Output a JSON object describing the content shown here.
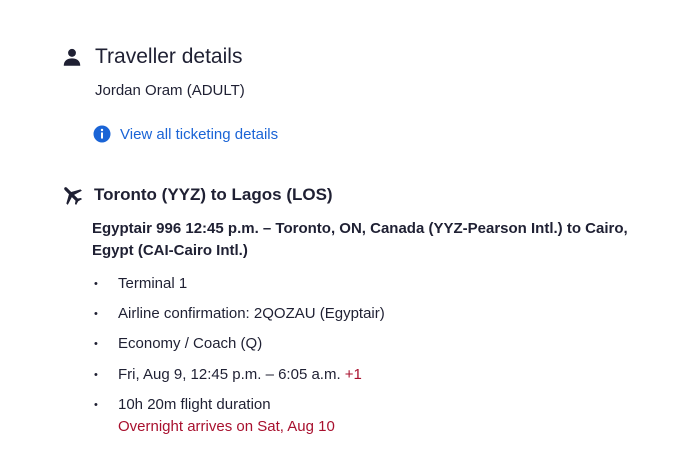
{
  "traveller": {
    "icon": "person-icon",
    "title": "Traveller details",
    "name": "Jordan Oram (ADULT)"
  },
  "ticketing": {
    "icon": "info-icon",
    "link_label": "View all ticketing details",
    "accent_color": "#1a64d6"
  },
  "flight": {
    "icon": "airplane-icon",
    "title": "Toronto (YYZ) to Lagos (LOS)",
    "segment": "Egyptair 996 12:45 p.m. – Toronto, ON, Canada (YYZ-Pearson Intl.) to Cairo, Egypt (CAI-Cairo Intl.)",
    "details": {
      "terminal": "Terminal 1",
      "confirmation": "Airline confirmation: 2QOZAU (Egyptair)",
      "cabin": "Economy / Coach (Q)",
      "times": "Fri, Aug 9, 12:45 p.m. – 6:05 a.m.",
      "day_offset": "+1",
      "duration": "10h 20m flight duration",
      "overnight_note": "Overnight arrives on Sat, Aug 10"
    },
    "alert_color": "#a8102e"
  }
}
